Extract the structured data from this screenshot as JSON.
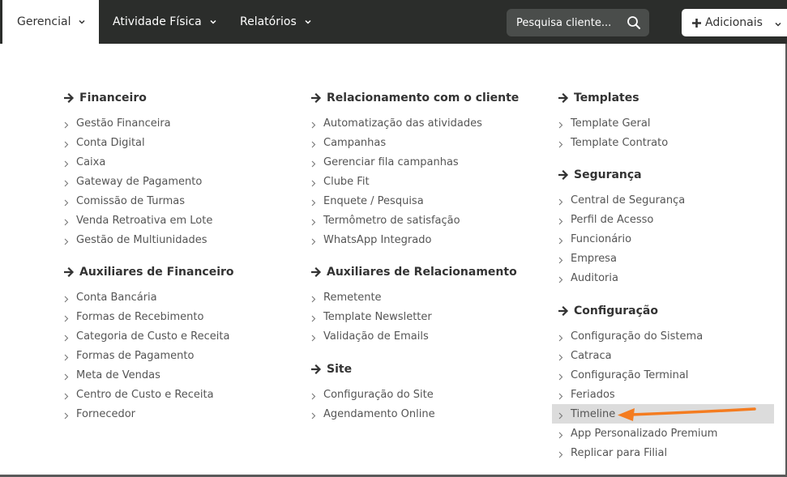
{
  "nav": {
    "items": [
      {
        "label": "Gerencial"
      },
      {
        "label": "Atividade Física"
      },
      {
        "label": "Relatórios"
      }
    ],
    "search_placeholder": "Pesquisa cliente...",
    "add_label": "Adicionais"
  },
  "menu": {
    "financeiro": {
      "title": "Financeiro",
      "items": [
        "Gestão Financeira",
        "Conta Digital",
        "Caixa",
        "Gateway de Pagamento",
        "Comissão de Turmas",
        "Venda Retroativa em Lote",
        "Gestão de Multiunidades"
      ]
    },
    "aux_financeiro": {
      "title": "Auxiliares de Financeiro",
      "items": [
        "Conta Bancária",
        "Formas de Recebimento",
        "Categoria de Custo e Receita",
        "Formas de Pagamento",
        "Meta de Vendas",
        "Centro de Custo e Receita",
        "Fornecedor"
      ]
    },
    "relacionamento": {
      "title": "Relacionamento com o cliente",
      "items": [
        "Automatização das atividades",
        "Campanhas",
        "Gerenciar fila campanhas",
        "Clube Fit",
        "Enquete / Pesquisa",
        "Termômetro de satisfação",
        "WhatsApp Integrado"
      ]
    },
    "aux_relacionamento": {
      "title": "Auxiliares de Relacionamento",
      "items": [
        "Remetente",
        "Template Newsletter",
        "Validação de Emails"
      ]
    },
    "site": {
      "title": "Site",
      "items": [
        "Configuração do Site",
        "Agendamento Online"
      ]
    },
    "templates": {
      "title": "Templates",
      "items": [
        "Template Geral",
        "Template Contrato"
      ]
    },
    "seguranca": {
      "title": "Segurança",
      "items": [
        "Central de Segurança",
        "Perfil de Acesso",
        "Funcionário",
        "Empresa",
        "Auditoria"
      ]
    },
    "configuracao": {
      "title": "Configuração",
      "items": [
        "Configuração do Sistema",
        "Catraca",
        "Configuração Terminal",
        "Feriados",
        "Timeline",
        "App Personalizado Premium",
        "Replicar para Filial"
      ]
    }
  },
  "colors": {
    "topbar": "#2b2d2b",
    "highlight": "#dcdcdc",
    "annotation_arrow": "#f47c20"
  }
}
